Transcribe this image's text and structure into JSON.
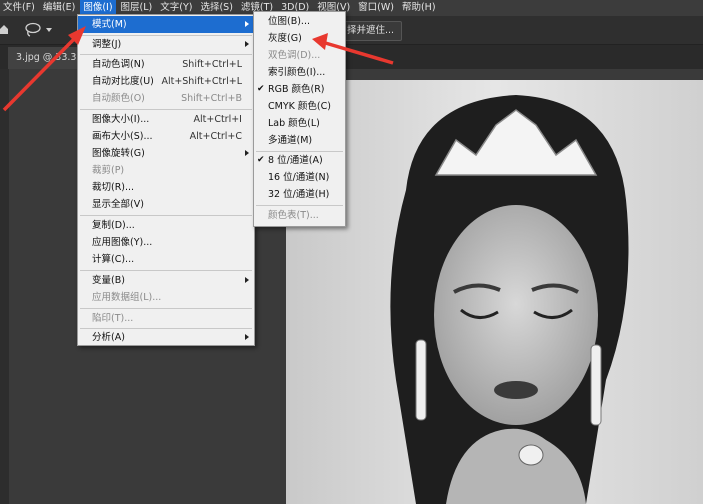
{
  "menubar": {
    "items": [
      "文件(F)",
      "编辑(E)",
      "图像(I)",
      "图层(L)",
      "文字(Y)",
      "选择(S)",
      "滤镜(T)",
      "3D(D)",
      "视图(V)",
      "窗口(W)",
      "帮助(H)"
    ]
  },
  "options_bar": {
    "button_label": "择并遮住..."
  },
  "document_tab": {
    "label": "3.jpg @ 33.3%"
  },
  "image_menu": {
    "items": [
      {
        "label": "模式(M)",
        "shortcut": "",
        "submenu": true,
        "disabled": false
      },
      {
        "label": "调整(J)",
        "shortcut": "",
        "submenu": true,
        "disabled": false
      },
      {
        "label": "自动色调(N)",
        "shortcut": "Shift+Ctrl+L",
        "submenu": false,
        "disabled": false
      },
      {
        "label": "自动对比度(U)",
        "shortcut": "Alt+Shift+Ctrl+L",
        "submenu": false,
        "disabled": false
      },
      {
        "label": "自动颜色(O)",
        "shortcut": "Shift+Ctrl+B",
        "submenu": false,
        "disabled": true
      },
      {
        "label": "图像大小(I)...",
        "shortcut": "Alt+Ctrl+I",
        "submenu": false,
        "disabled": false
      },
      {
        "label": "画布大小(S)...",
        "shortcut": "Alt+Ctrl+C",
        "submenu": false,
        "disabled": false
      },
      {
        "label": "图像旋转(G)",
        "shortcut": "",
        "submenu": true,
        "disabled": false
      },
      {
        "label": "裁剪(P)",
        "shortcut": "",
        "submenu": false,
        "disabled": true
      },
      {
        "label": "裁切(R)...",
        "shortcut": "",
        "submenu": false,
        "disabled": false
      },
      {
        "label": "显示全部(V)",
        "shortcut": "",
        "submenu": false,
        "disabled": false
      },
      {
        "label": "复制(D)...",
        "shortcut": "",
        "submenu": false,
        "disabled": false
      },
      {
        "label": "应用图像(Y)...",
        "shortcut": "",
        "submenu": false,
        "disabled": false
      },
      {
        "label": "计算(C)...",
        "shortcut": "",
        "submenu": false,
        "disabled": false
      },
      {
        "label": "变量(B)",
        "shortcut": "",
        "submenu": true,
        "disabled": false
      },
      {
        "label": "应用数据组(L)...",
        "shortcut": "",
        "submenu": false,
        "disabled": true
      },
      {
        "label": "陷印(T)...",
        "shortcut": "",
        "submenu": false,
        "disabled": true
      },
      {
        "label": "分析(A)",
        "shortcut": "",
        "submenu": true,
        "disabled": false
      }
    ]
  },
  "mode_submenu": {
    "items": [
      {
        "label": "位图(B)...",
        "checked": false,
        "disabled": false
      },
      {
        "label": "灰度(G)",
        "checked": false,
        "disabled": false
      },
      {
        "label": "双色调(D)...",
        "checked": false,
        "disabled": true
      },
      {
        "label": "索引颜色(I)...",
        "checked": false,
        "disabled": false
      },
      {
        "label": "RGB 颜色(R)",
        "checked": true,
        "disabled": false
      },
      {
        "label": "CMYK 颜色(C)",
        "checked": false,
        "disabled": false
      },
      {
        "label": "Lab 颜色(L)",
        "checked": false,
        "disabled": false
      },
      {
        "label": "多通道(M)",
        "checked": false,
        "disabled": false
      },
      {
        "label": "8 位/通道(A)",
        "checked": true,
        "disabled": false
      },
      {
        "label": "16 位/通道(N)",
        "checked": false,
        "disabled": false
      },
      {
        "label": "32 位/通道(H)",
        "checked": false,
        "disabled": false
      },
      {
        "label": "颜色表(T)...",
        "checked": false,
        "disabled": true
      }
    ]
  },
  "colors": {
    "highlight": "#1d6dd0",
    "annotation_arrow": "#e8382f"
  }
}
